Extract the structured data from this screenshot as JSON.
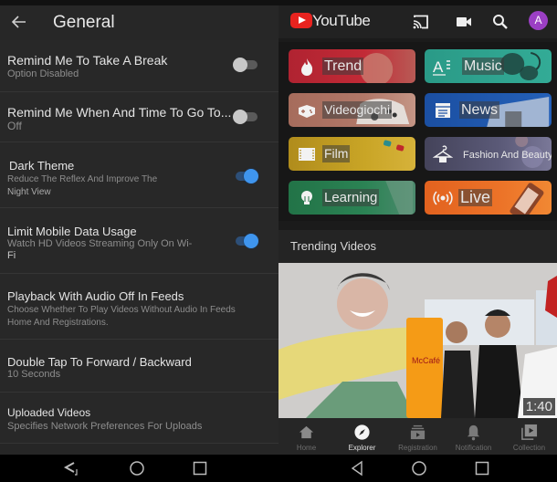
{
  "left": {
    "header": {
      "title": "General",
      "back_icon": "arrow-left-icon"
    },
    "settings": [
      {
        "title": "Remind Me To Take A Break",
        "subtitle": "Option Disabled",
        "toggle": false
      },
      {
        "title": "Remind Me When And Time To Go To...",
        "subtitle": "Off",
        "toggle": false
      },
      {
        "title": "Dark Theme",
        "subtitle": "Reduce The Reflex And Improve The",
        "subtitle2": "Night View",
        "toggle": true
      },
      {
        "title": "Limit Mobile Data Usage",
        "subtitle": "Watch HD Videos Streaming Only On Wi-",
        "subtitle2": "Fi",
        "toggle": true
      },
      {
        "title": "Playback With Audio Off In Feeds",
        "subtitle": "Choose Whether To Play Videos Without Audio In Feeds",
        "subtitle2": "Home And Registrations."
      },
      {
        "title": "Double Tap To Forward / Backward",
        "subtitle": "10 Seconds"
      },
      {
        "title": "Uploaded Videos",
        "subtitle": "Specifies Network Preferences For Uploads"
      }
    ],
    "nav": [
      "back-icon",
      "home-icon",
      "recents-icon"
    ]
  },
  "right": {
    "header": {
      "logo_text": "YouTube",
      "icons": [
        "cast-icon",
        "video-camera-icon",
        "search-icon"
      ],
      "avatar_letter": "A",
      "avatar_color": "#9b3fc4"
    },
    "categories": [
      {
        "label": "Trend",
        "icon": "flame-icon",
        "color": "#b3242f"
      },
      {
        "label": "Music",
        "icon": "music-icon",
        "color": "#2c9c88"
      },
      {
        "label": "Videogiochi",
        "icon": "gamepad-icon",
        "color": "#a8705f"
      },
      {
        "label": "News",
        "icon": "newspaper-icon",
        "color": "#1e56a8"
      },
      {
        "label": "Film",
        "icon": "film-icon",
        "color": "#b8921f"
      },
      {
        "label": "Fashion And Beauty",
        "icon": "hanger-icon",
        "color": "#4e4c68"
      },
      {
        "label": "Learning",
        "icon": "lightbulb-icon",
        "color": "#24784e"
      },
      {
        "label": "Live",
        "icon": "live-broadcast-icon",
        "color": "#e76a22"
      }
    ],
    "trending_title": "Trending Videos",
    "video": {
      "duration": "1:40"
    },
    "bottom_nav": [
      {
        "label": "Home",
        "icon": "home-icon",
        "active": false
      },
      {
        "label": "Explorer",
        "icon": "compass-icon",
        "active": true
      },
      {
        "label": "Registration",
        "icon": "subscriptions-icon",
        "active": false
      },
      {
        "label": "Notification",
        "icon": "bell-icon",
        "active": false
      },
      {
        "label": "Collection",
        "icon": "library-icon",
        "active": false
      }
    ]
  }
}
